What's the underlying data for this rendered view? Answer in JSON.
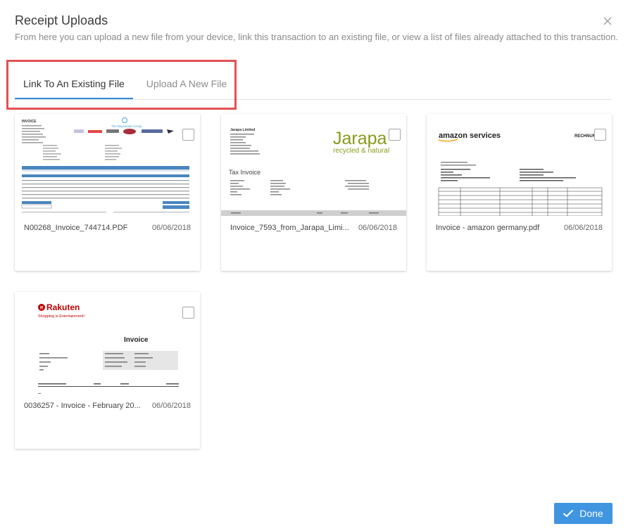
{
  "dialog": {
    "title": "Receipt Uploads",
    "subtitle": "From here you can upload a new file from your device, link this transaction to an existing file, or view a list of files already attached to this transaction."
  },
  "tabs": [
    {
      "label": "Link To An Existing File",
      "active": true
    },
    {
      "label": "Upload A New File",
      "active": false
    }
  ],
  "files": [
    {
      "name": "N00268_Invoice_744714.PDF",
      "date": "06/06/2018",
      "preview": {
        "heading": "INVOICE",
        "brand": "The Bayswater Group"
      }
    },
    {
      "name": "Invoice_7593_from_Jarapa_Limi...",
      "date": "06/06/2018",
      "preview": {
        "company": "Jarapa Limited",
        "brand": "Jarapa",
        "tagline": "recycled & natural",
        "heading": "Tax Invoice"
      }
    },
    {
      "name": "Invoice - amazon germany.pdf",
      "date": "06/06/2018",
      "preview": {
        "brand": "amazon services",
        "heading": "RECHNUNG"
      }
    },
    {
      "name": "0036257 - Invoice - February 20...",
      "date": "06/06/2018",
      "preview": {
        "brand": "Rakuten",
        "tagline": "Shopping is Entertainment!",
        "heading": "Invoice"
      }
    }
  ],
  "actions": {
    "done_label": "Done"
  },
  "colors": {
    "accent": "#3f95e0",
    "tab_underline": "#2e88d8",
    "highlight": "#e05252",
    "jarapa": "#8a9a1b",
    "rakuten": "#bf0000"
  }
}
